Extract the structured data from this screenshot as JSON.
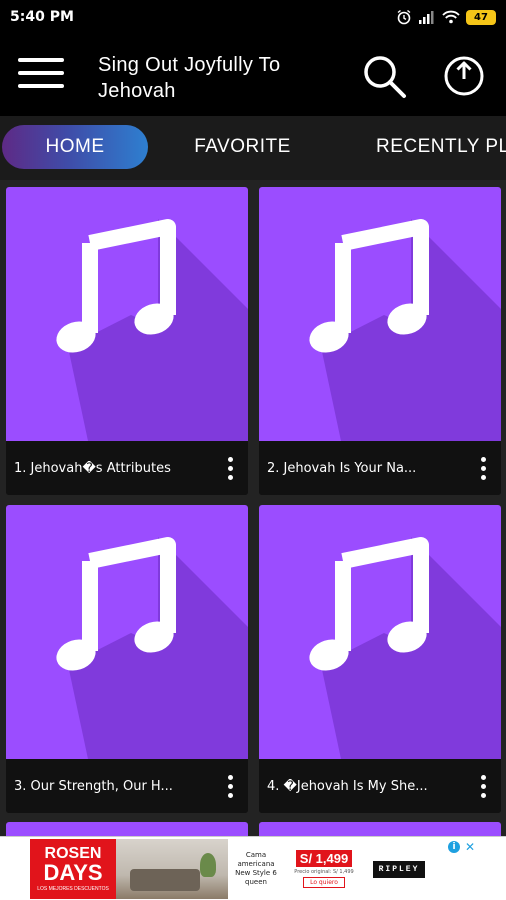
{
  "status_bar": {
    "time": "5:40 PM",
    "battery": "47"
  },
  "app_bar": {
    "title": "Sing Out Joyfully To Jehovah"
  },
  "tabs": [
    {
      "label": "HOME",
      "active": true
    },
    {
      "label": "FAVORITE",
      "active": false
    },
    {
      "label": "RECENTLY PLAYED",
      "active": false
    }
  ],
  "songs": [
    {
      "title": "1. Jehovah�s Attributes"
    },
    {
      "title": "2. Jehovah Is Your Na..."
    },
    {
      "title": "3. Our Strength, Our H..."
    },
    {
      "title": "4. �Jehovah Is My She..."
    }
  ],
  "colors": {
    "card_art": "#9b4dff",
    "note": "#ffffff",
    "tab_gradient_start": "#5e2a86",
    "tab_gradient_end": "#2e7fd0"
  },
  "ad": {
    "brand_line1": "ROSEN",
    "brand_line2": "DAYS",
    "brand_line3": "LOS MEJORES DESCUENTOS",
    "product_line1": "Cama americana",
    "product_line2": "New Style 6",
    "product_line3": "queen",
    "price": "S/ 1,499",
    "original_price": "Precio original: S/ 1,499",
    "cta": "Lo quiero",
    "store": "RIPLEY",
    "info_icon": "info-icon",
    "close_icon": "close-icon"
  }
}
